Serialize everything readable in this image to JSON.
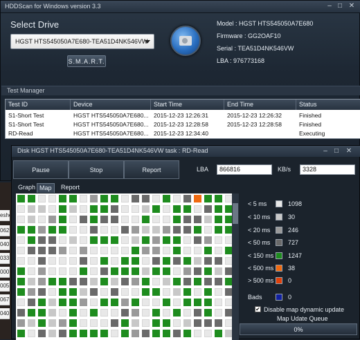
{
  "main_window": {
    "title": "HDDScan for Windows version 3.3",
    "select_drive_label": "Select Drive",
    "drive_value": "HGST HTS545050A7E680-TEA51D4NK546VW",
    "smart_button": "S.M.A.R.T.",
    "model": "Model : HGST HTS545050A7E680",
    "firmware": "Firmware : GG2OAF10",
    "serial": "Serial : TEA51D4NK546VW",
    "lba": "LBA : 976773168"
  },
  "test_manager": {
    "title": "Test Manager",
    "columns": [
      "Test ID",
      "Device",
      "Start Time",
      "End Time",
      "Status"
    ],
    "rows": [
      [
        "S1-Short Test",
        "HGST HTS545050A7E680...",
        "2015-12-23 12:26:31",
        "2015-12-23 12:26:32",
        "Finished"
      ],
      [
        "S1-Short Test",
        "HGST HTS545050A7E680...",
        "2015-12-23 12:28:58",
        "2015-12-23 12:28:58",
        "Finished"
      ],
      [
        "RD-Read",
        "HGST HTS545050A7E680...",
        "2015-12-23 12:34:40",
        "",
        "Executing"
      ]
    ]
  },
  "disk_window": {
    "title": "Disk HGST HTS545050A7E680-TEA51D4NK546VW   task : RD-Read",
    "pause_button": "Pause",
    "stop_button": "Stop",
    "report_button": "Report",
    "lba_label": "LBA",
    "lba_value": "866816",
    "kbs_label": "KB/s",
    "kbs_value": "3328",
    "tabs": [
      "Graph",
      "Map",
      "Report"
    ],
    "legend": [
      {
        "label": "< 5 ms",
        "color": "#e8e8e8",
        "count": "1098"
      },
      {
        "label": "< 10 ms",
        "color": "#c8c8c8",
        "count": "30"
      },
      {
        "label": "< 20 ms",
        "color": "#9a9a9a",
        "count": "246"
      },
      {
        "label": "< 50 ms",
        "color": "#6a6a6a",
        "count": "727"
      },
      {
        "label": "< 150 ms",
        "color": "#1e8c1e",
        "count": "1247"
      },
      {
        "label": "< 500 ms",
        "color": "#f06a10",
        "count": "38"
      },
      {
        "label": "> 500 ms",
        "color": "#e0400a",
        "count": "0"
      },
      {
        "label": "Bads",
        "color": "#1020a0",
        "count": "0"
      }
    ],
    "disable_dynamic_label": "Disable map dynamic update",
    "queue_label": "Map Udate Queue",
    "progress": "0%"
  },
  "left_remnants": [
    "esho",
    "062",
    "040",
    "033",
    "000",
    "005",
    "067",
    "040"
  ]
}
